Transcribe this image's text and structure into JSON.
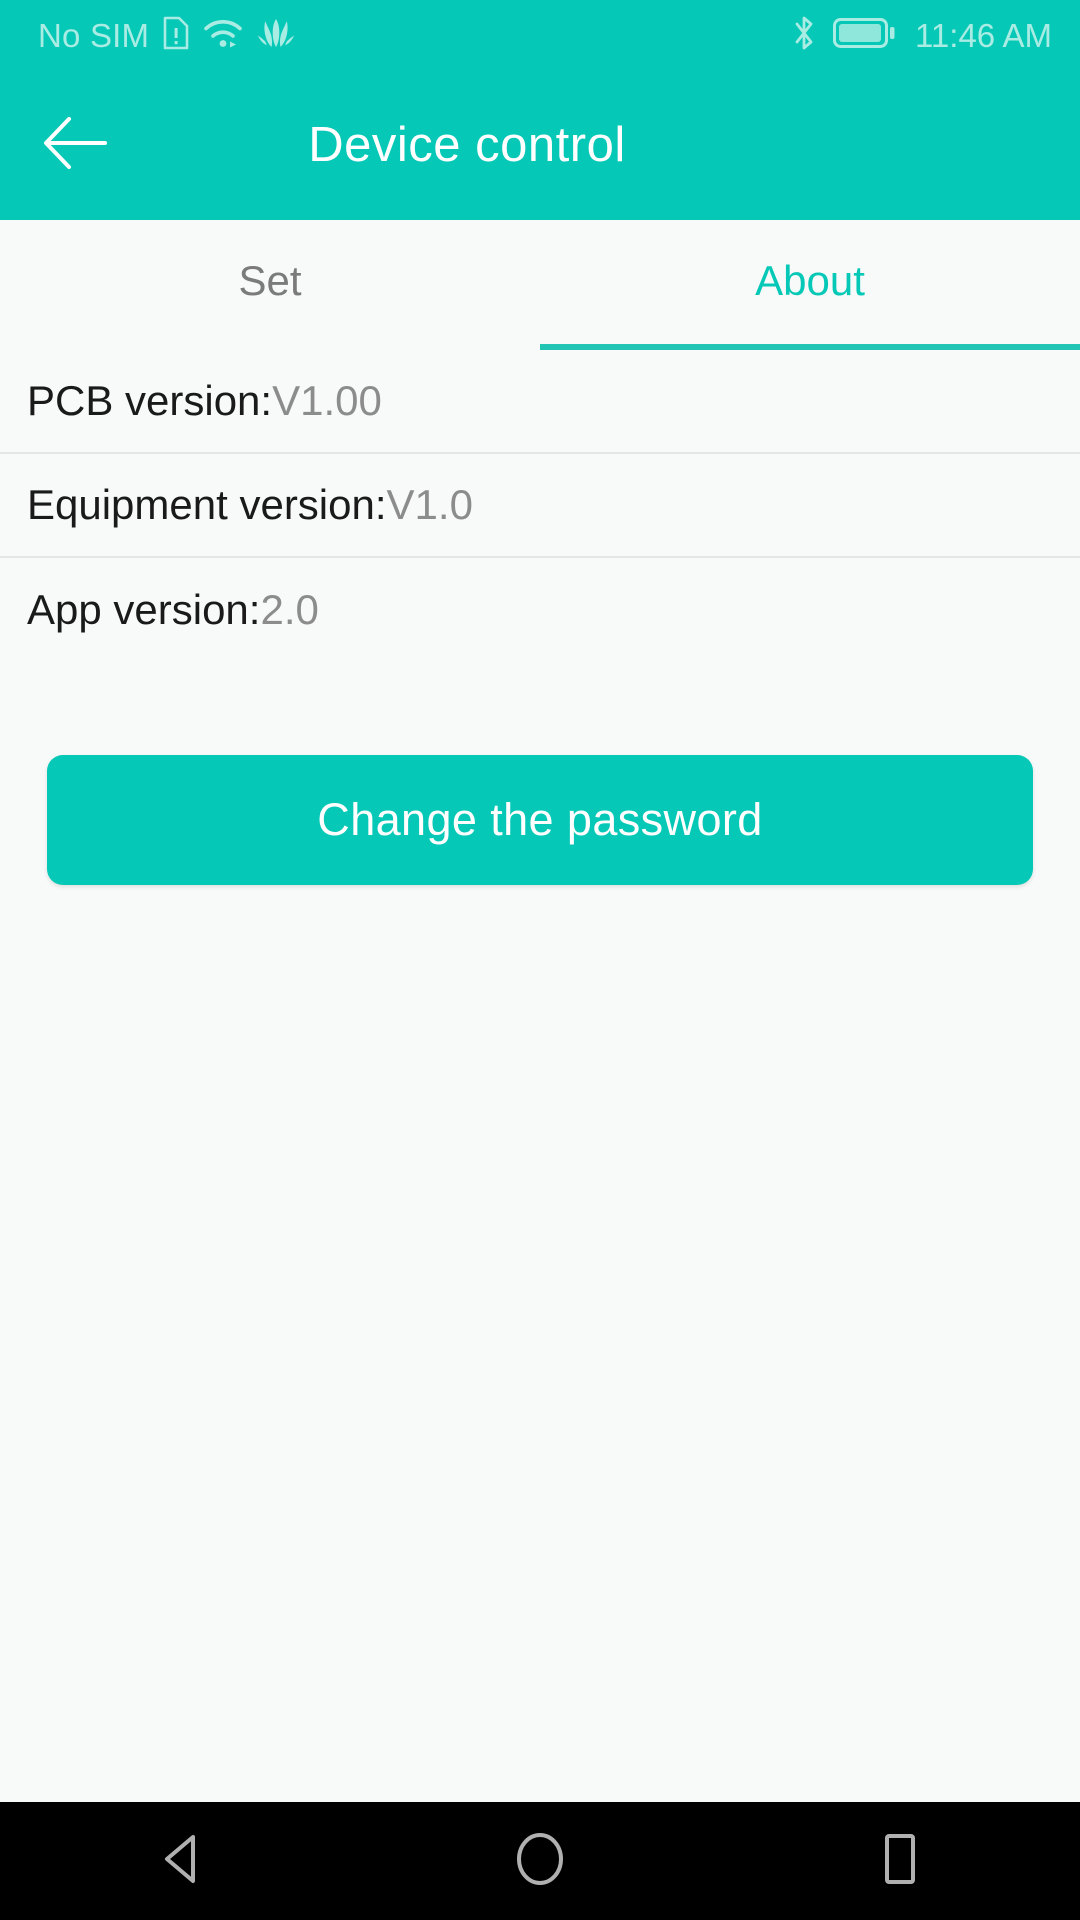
{
  "status_bar": {
    "carrier": "No SIM",
    "time": "11:46 AM",
    "icons": [
      "sim-alert-icon",
      "wifi-icon",
      "huawei-logo-icon",
      "bluetooth-icon",
      "battery-icon"
    ],
    "text_color": "#a8ece3",
    "background": "#06c8b6"
  },
  "app_bar": {
    "title": "Device control",
    "back_icon": "arrow-left-icon",
    "background": "#06c8b6",
    "title_color": "#ffffff"
  },
  "tabs": {
    "items": [
      {
        "label": "Set",
        "active": false
      },
      {
        "label": "About",
        "active": true
      }
    ],
    "active_color": "#06c8b6",
    "inactive_color": "#7b7b7b",
    "indicator_color": "#22c4b3"
  },
  "info_rows": [
    {
      "label": "PCB version:",
      "value": "V1.00"
    },
    {
      "label": "Equipment version:",
      "value": "V1.0"
    },
    {
      "label": "App version:",
      "value": "2.0"
    }
  ],
  "primary_button": {
    "label": "Change the password",
    "background": "#06c8b6",
    "text_color": "#ffffff"
  },
  "nav_bar": {
    "back": "nav-back-icon",
    "home": "nav-home-icon",
    "recents": "nav-recents-icon",
    "background": "#000000",
    "icon_color": "#b0b0b0"
  }
}
